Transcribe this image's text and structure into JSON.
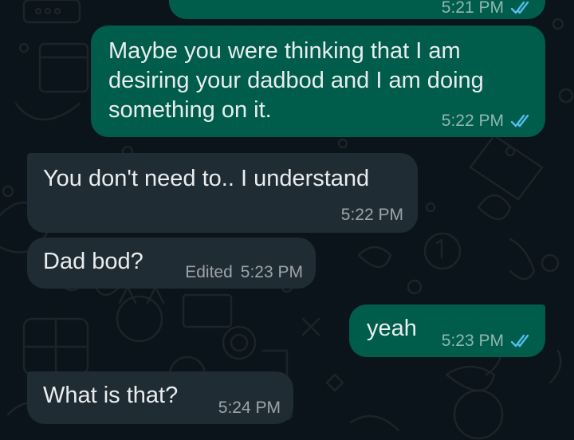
{
  "chat": {
    "messages": [
      {
        "id": "m0",
        "direction": "outgoing",
        "text": "",
        "time": "5:21 PM",
        "status_icon": "double-check-read-icon"
      },
      {
        "id": "m1",
        "direction": "outgoing",
        "text": "Maybe you were thinking that I am\ndesiring your dadbod and I am doing\nsomething on it.",
        "time": "5:22 PM",
        "status_icon": "double-check-read-icon"
      },
      {
        "id": "m2",
        "direction": "incoming",
        "text": "You don't need to.. I understand",
        "time": "5:22 PM"
      },
      {
        "id": "m3",
        "direction": "incoming",
        "text": "Dad bod?",
        "edited_label": "Edited",
        "time": "5:23 PM"
      },
      {
        "id": "m4",
        "direction": "outgoing",
        "text": "yeah",
        "time": "5:23 PM",
        "status_icon": "double-check-read-icon"
      },
      {
        "id": "m5",
        "direction": "incoming",
        "text": "What is that?",
        "time": "5:24 PM"
      }
    ]
  },
  "colors": {
    "background": "#0b141a",
    "outgoing_bubble": "#005c4b",
    "incoming_bubble": "#202c33",
    "read_ticks": "#53bdeb",
    "text": "#e9edef"
  }
}
